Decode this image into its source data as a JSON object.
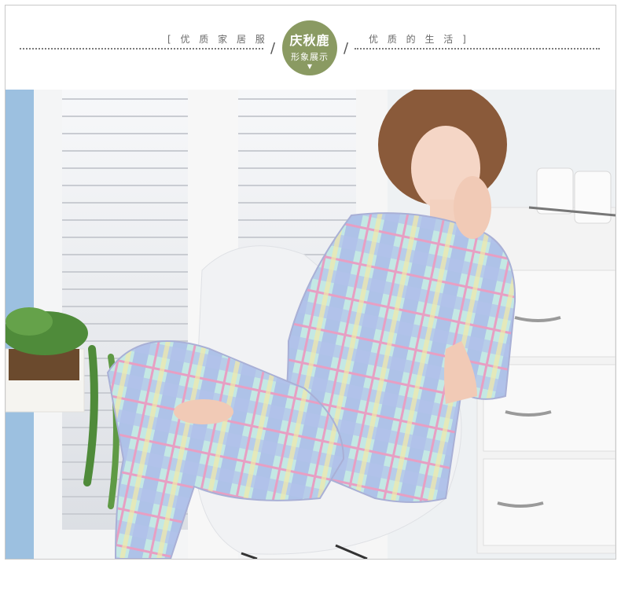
{
  "header": {
    "tagline_left": "[ 优 质 家 居 服",
    "tagline_right": "优 质 的 生 活 ]",
    "slash": "/",
    "brand": "秋鹿",
    "brand_prefix": "庆",
    "brand_subtitle": "形象展示",
    "arrow": "▼"
  },
  "photo": {
    "description_icons": [
      "window-blinds",
      "plant",
      "chair",
      "drawer-cabinet",
      "canisters"
    ]
  },
  "colors": {
    "badge": "#8a9a62",
    "border": "#c9c9c9",
    "wall": "#eef1f4",
    "pajama_blue": "#9fb6e6",
    "pajama_mint": "#bfe9e2",
    "pajama_pink": "#e7a9c6"
  }
}
